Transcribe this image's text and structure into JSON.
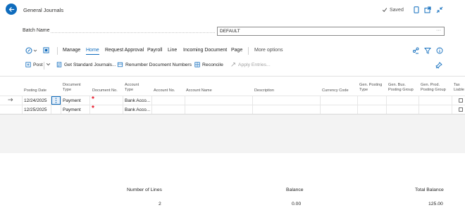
{
  "header": {
    "title": "General Journals",
    "saved": "Saved"
  },
  "batch": {
    "label": "Batch Name",
    "value": "DEFAULT"
  },
  "menu": {
    "items": [
      "Manage",
      "Home",
      "Request Approval",
      "Payroll",
      "Line",
      "Incoming Document",
      "Page"
    ],
    "more": "More options",
    "active": "Home"
  },
  "actions": {
    "post": "Post",
    "get_standard": "Get Standard Journals...",
    "renumber": "Renumber Document Numbers",
    "reconcile": "Reconcile",
    "apply_entries": "Apply Entries..."
  },
  "table": {
    "columns": [
      "Posting Date",
      "Document Type",
      "Document No.",
      "Account Type",
      "Account No.",
      "Account Name",
      "Description",
      "Currency Code",
      "Gen. Posting Type",
      "Gen. Bus. Posting Group",
      "Gen. Prod. Posting Group",
      "Tax Liable"
    ],
    "rows": [
      {
        "posting_date": "12/24/2025",
        "document_type": "Payment",
        "account_type": "Bank Acco..."
      },
      {
        "posting_date": "12/25/2025",
        "document_type": "Payment",
        "account_type": "Bank Acco..."
      }
    ]
  },
  "footer": {
    "number_of_lines_label": "Number of Lines",
    "number_of_lines": "2",
    "balance_label": "Balance",
    "balance": "0.00",
    "total_balance_label": "Total Balance",
    "total_balance": "125.00"
  },
  "colors": {
    "accent": "#0f6cbd",
    "required": "#e81123"
  }
}
